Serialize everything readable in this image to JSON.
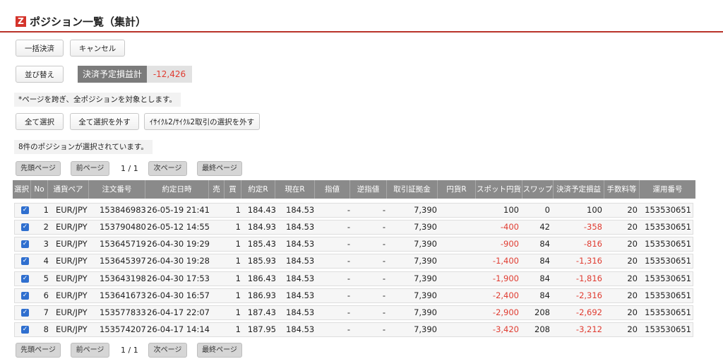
{
  "header": {
    "logo": "Z",
    "title": "ポジション一覧（集計）"
  },
  "actions": {
    "bulk_settle": "一括決済",
    "cancel": "キャンセル",
    "sort": "並び替え",
    "pl_label": "決済予定損益計",
    "pl_value": "-12,426"
  },
  "notes": {
    "cross_page": "*ページを跨ぎ、全ポジションを対象とします。",
    "selected_count": "8件のポジションが選択されています。"
  },
  "selection": {
    "select_all": "全て選択",
    "deselect_all": "全て選択を外す",
    "deselect_cycle": "ｲｻｲｸﾙ2/ｻｲｸﾙ2取引の選択を外す"
  },
  "pager": {
    "first": "先頭ページ",
    "prev": "前ページ",
    "current": "1",
    "sep": "/",
    "total": "1",
    "next": "次ページ",
    "last": "最終ページ"
  },
  "table": {
    "headers": [
      "選択",
      "No",
      "通貨ペア",
      "注文番号",
      "約定日時",
      "売",
      "買",
      "約定R",
      "現在R",
      "指値",
      "逆指値",
      "取引証拠金",
      "円貨R",
      "スポット円貨",
      "スワップ",
      "決済予定損益",
      "手数料等",
      "運用番号"
    ],
    "rows": [
      {
        "no": "1",
        "pair": "EUR/JPY",
        "order": "153846983",
        "datetime": "26-05-19 21:41",
        "sell": "",
        "buy": "1",
        "rate": "184.43",
        "current": "184.53",
        "limit": "-",
        "stop": "-",
        "margin": "7,390",
        "yen_rate": "",
        "spot": "100",
        "swap": "0",
        "pl": "100",
        "fee": "20",
        "op_no": "153530651"
      },
      {
        "no": "2",
        "pair": "EUR/JPY",
        "order": "153790480",
        "datetime": "26-05-12 14:55",
        "sell": "",
        "buy": "1",
        "rate": "184.93",
        "current": "184.53",
        "limit": "-",
        "stop": "-",
        "margin": "7,390",
        "yen_rate": "",
        "spot": "-400",
        "swap": "42",
        "pl": "-358",
        "fee": "20",
        "op_no": "153530651"
      },
      {
        "no": "3",
        "pair": "EUR/JPY",
        "order": "153645719",
        "datetime": "26-04-30 19:29",
        "sell": "",
        "buy": "1",
        "rate": "185.43",
        "current": "184.53",
        "limit": "-",
        "stop": "-",
        "margin": "7,390",
        "yen_rate": "",
        "spot": "-900",
        "swap": "84",
        "pl": "-816",
        "fee": "20",
        "op_no": "153530651"
      },
      {
        "no": "4",
        "pair": "EUR/JPY",
        "order": "153645397",
        "datetime": "26-04-30 19:28",
        "sell": "",
        "buy": "1",
        "rate": "185.93",
        "current": "184.53",
        "limit": "-",
        "stop": "-",
        "margin": "7,390",
        "yen_rate": "",
        "spot": "-1,400",
        "swap": "84",
        "pl": "-1,316",
        "fee": "20",
        "op_no": "153530651"
      },
      {
        "no": "5",
        "pair": "EUR/JPY",
        "order": "153643198",
        "datetime": "26-04-30 17:53",
        "sell": "",
        "buy": "1",
        "rate": "186.43",
        "current": "184.53",
        "limit": "-",
        "stop": "-",
        "margin": "7,390",
        "yen_rate": "",
        "spot": "-1,900",
        "swap": "84",
        "pl": "-1,816",
        "fee": "20",
        "op_no": "153530651"
      },
      {
        "no": "6",
        "pair": "EUR/JPY",
        "order": "153641673",
        "datetime": "26-04-30 16:57",
        "sell": "",
        "buy": "1",
        "rate": "186.93",
        "current": "184.53",
        "limit": "-",
        "stop": "-",
        "margin": "7,390",
        "yen_rate": "",
        "spot": "-2,400",
        "swap": "84",
        "pl": "-2,316",
        "fee": "20",
        "op_no": "153530651"
      },
      {
        "no": "7",
        "pair": "EUR/JPY",
        "order": "153577833",
        "datetime": "26-04-17 22:07",
        "sell": "",
        "buy": "1",
        "rate": "187.43",
        "current": "184.53",
        "limit": "-",
        "stop": "-",
        "margin": "7,390",
        "yen_rate": "",
        "spot": "-2,900",
        "swap": "208",
        "pl": "-2,692",
        "fee": "20",
        "op_no": "153530651"
      },
      {
        "no": "8",
        "pair": "EUR/JPY",
        "order": "153574207",
        "datetime": "26-04-17 14:14",
        "sell": "",
        "buy": "1",
        "rate": "187.95",
        "current": "184.53",
        "limit": "-",
        "stop": "-",
        "margin": "7,390",
        "yen_rate": "",
        "spot": "-3,420",
        "swap": "208",
        "pl": "-3,212",
        "fee": "20",
        "op_no": "153530651"
      }
    ]
  },
  "colors": {
    "accent": "#b9332a",
    "negative": "#e03c31",
    "checkbox": "#2f6fcf",
    "header_bg": "#8a8a8a"
  }
}
